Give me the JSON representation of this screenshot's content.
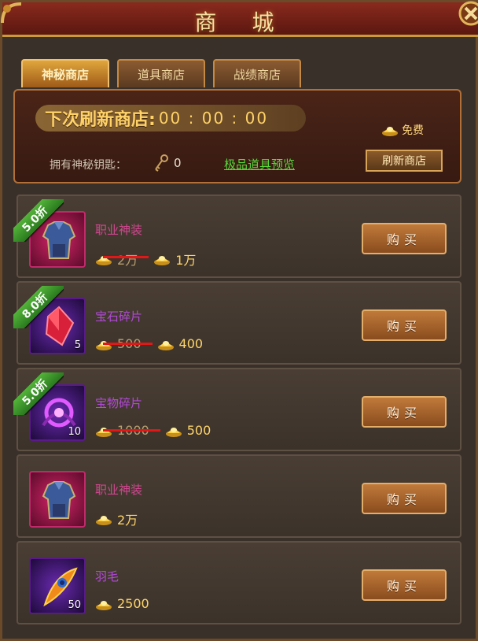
{
  "window": {
    "title": "商 城"
  },
  "tabs": [
    {
      "label": "神秘商店",
      "active": true
    },
    {
      "label": "道具商店",
      "active": false
    },
    {
      "label": "战绩商店",
      "active": false
    }
  ],
  "refresh": {
    "label": "下次刷新商店:",
    "timer": "00 : 00 : 00",
    "free_label": "免费",
    "keys_label": "拥有神秘钥匙：",
    "keys_count": "0",
    "preview_link": "极品道具预览",
    "refresh_button": "刷新商店"
  },
  "items": [
    {
      "name": "职业神装",
      "discount": "5.0折",
      "count": "",
      "original_price": "2万",
      "price": "1万",
      "buy_label": "购买",
      "icon": "armor-icon"
    },
    {
      "name": "宝石碎片",
      "discount": "8.0折",
      "count": "5",
      "original_price": "500",
      "price": "400",
      "buy_label": "购买",
      "icon": "gem-icon"
    },
    {
      "name": "宝物碎片",
      "discount": "5.0折",
      "count": "10",
      "original_price": "1000",
      "price": "500",
      "buy_label": "购买",
      "icon": "treasure-icon"
    },
    {
      "name": "职业神装",
      "discount": "",
      "count": "",
      "original_price": "",
      "price": "2万",
      "buy_label": "购买",
      "icon": "armor-icon"
    },
    {
      "name": "羽毛",
      "discount": "",
      "count": "50",
      "original_price": "",
      "price": "2500",
      "buy_label": "购买",
      "icon": "feather-icon"
    }
  ],
  "colors": {
    "accent": "#ffd268",
    "discount_green": "#3c9a2a",
    "strike_red": "#e01818"
  }
}
